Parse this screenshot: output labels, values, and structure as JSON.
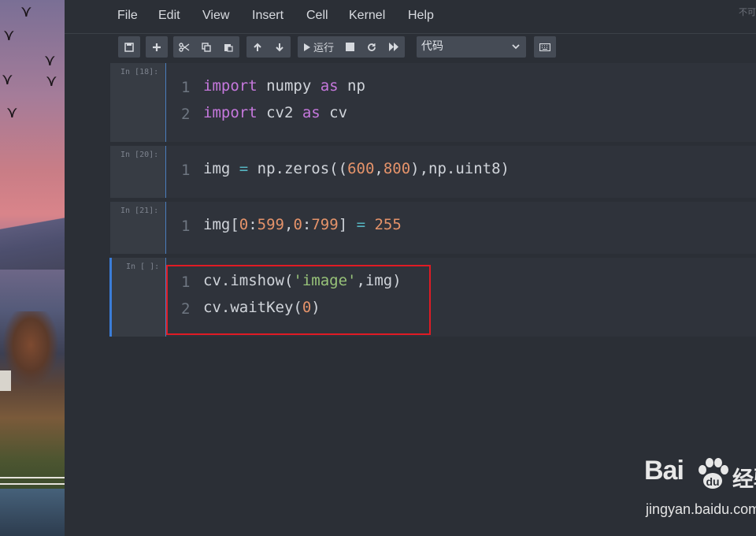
{
  "menubar": {
    "items": [
      "File",
      "Edit",
      "View",
      "Insert",
      "Cell",
      "Kernel",
      "Help"
    ],
    "status": "不可"
  },
  "toolbar": {
    "run_label": "运行",
    "cell_type": "代码",
    "icons": [
      "save-icon",
      "plus-icon",
      "cut-icon",
      "copy-icon",
      "paste-icon",
      "arrow-up-icon",
      "arrow-down-icon",
      "run-icon",
      "stop-icon",
      "restart-icon",
      "fast-forward-icon",
      "keyboard-icon"
    ]
  },
  "cells": [
    {
      "prompt": "In [18]:",
      "lines": [
        {
          "n": "1",
          "tokens": [
            [
              "kw",
              "import"
            ],
            [
              "id",
              " numpy "
            ],
            [
              "kw",
              "as"
            ],
            [
              "id",
              " np"
            ]
          ]
        },
        {
          "n": "2",
          "tokens": [
            [
              "kw",
              "import"
            ],
            [
              "id",
              " cv2 "
            ],
            [
              "kw",
              "as"
            ],
            [
              "id",
              " cv"
            ]
          ]
        }
      ]
    },
    {
      "prompt": "In [20]:",
      "lines": [
        {
          "n": "1",
          "tokens": [
            [
              "id",
              "img "
            ],
            [
              "op",
              "="
            ],
            [
              "id",
              " np.zeros(("
            ],
            [
              "num",
              "600"
            ],
            [
              "id",
              ","
            ],
            [
              "num",
              "800"
            ],
            [
              "id",
              "),np.uint8)"
            ]
          ]
        }
      ]
    },
    {
      "prompt": "In [21]:",
      "lines": [
        {
          "n": "1",
          "tokens": [
            [
              "id",
              "img["
            ],
            [
              "num",
              "0"
            ],
            [
              "id",
              ":"
            ],
            [
              "num",
              "599"
            ],
            [
              "id",
              ","
            ],
            [
              "num",
              "0"
            ],
            [
              "id",
              ":"
            ],
            [
              "num",
              "799"
            ],
            [
              "id",
              "] "
            ],
            [
              "op",
              "="
            ],
            [
              "id",
              " "
            ],
            [
              "num",
              "255"
            ]
          ]
        }
      ]
    },
    {
      "prompt": "In [ ]:",
      "lines": [
        {
          "n": "1",
          "tokens": [
            [
              "id",
              "cv.imshow("
            ],
            [
              "str",
              "'image'"
            ],
            [
              "id",
              ",img)"
            ]
          ]
        },
        {
          "n": "2",
          "tokens": [
            [
              "id",
              "cv.waitKey("
            ],
            [
              "num",
              "0"
            ],
            [
              "id",
              ")"
            ]
          ]
        }
      ]
    }
  ],
  "watermark": {
    "logo": "Bai",
    "logo_suffix": "经验",
    "url": "jingyan.baidu.com"
  }
}
